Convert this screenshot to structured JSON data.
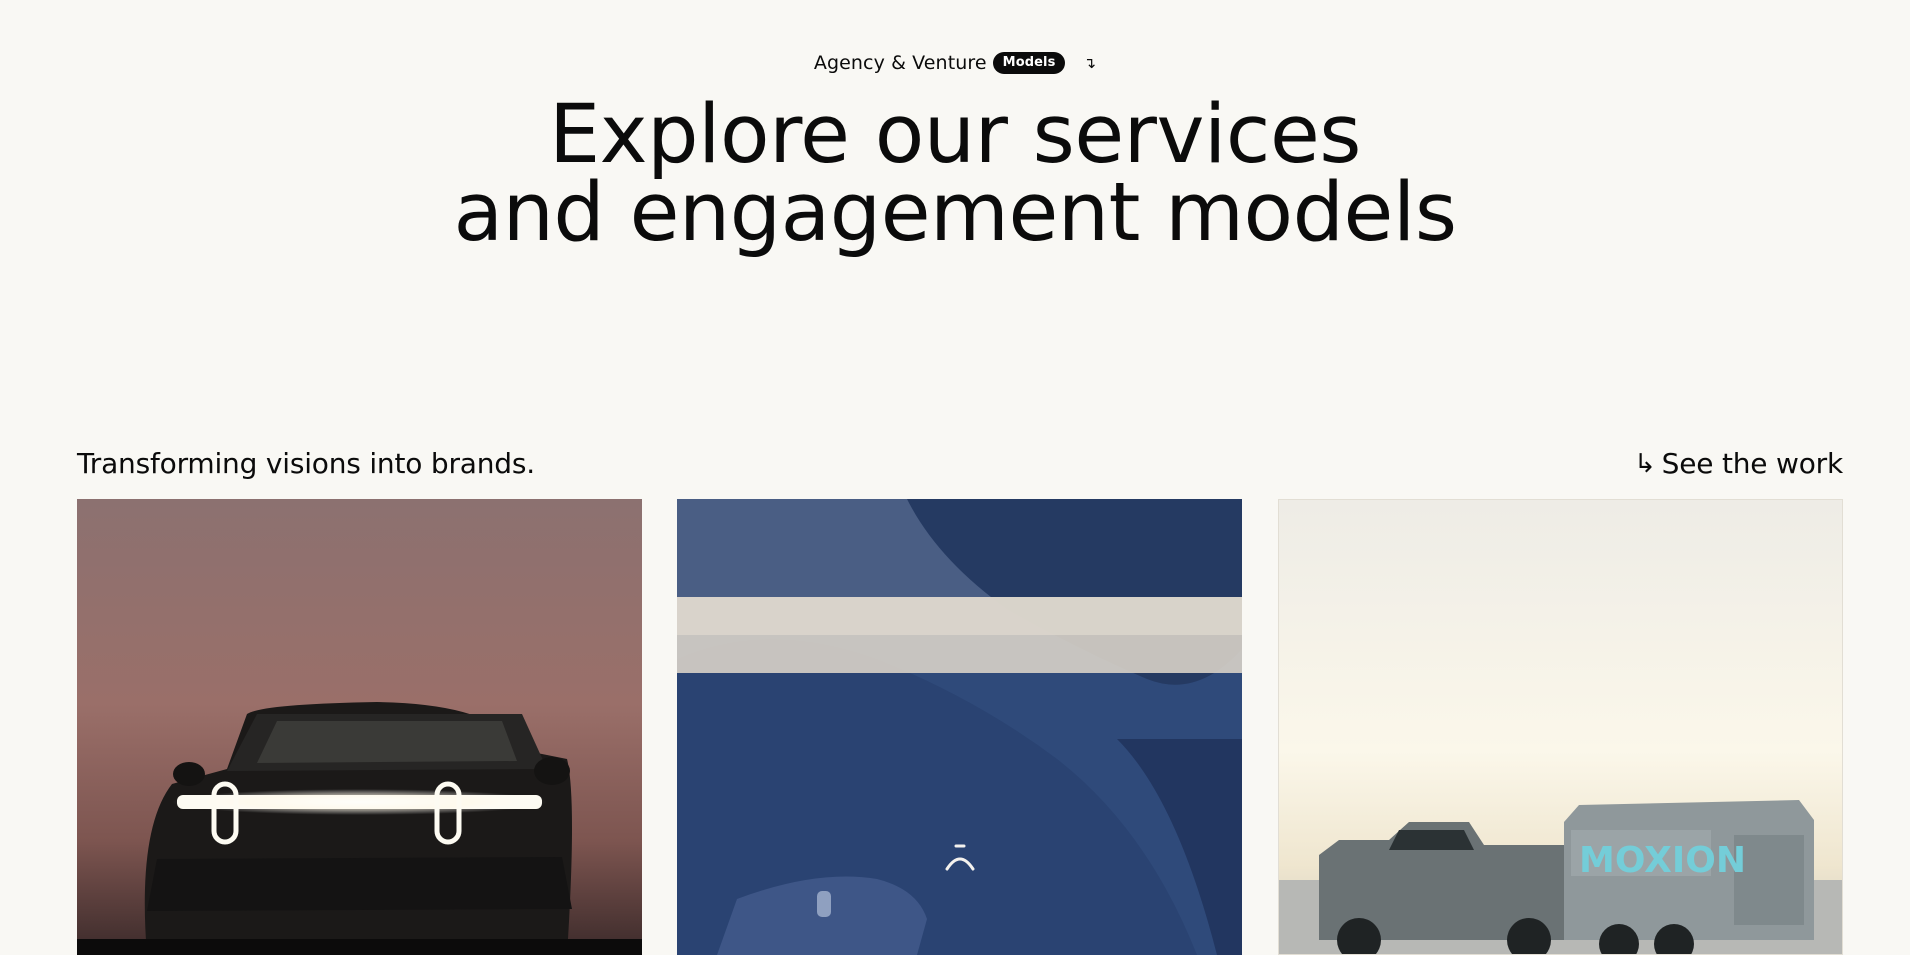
{
  "eyebrow": {
    "text": "Agency & Venture",
    "pill": "Models",
    "arrow": "↴"
  },
  "headline": {
    "line1": "Explore our services",
    "line2": "and engagement models"
  },
  "section": {
    "title": "Transforming visions into brands.",
    "link_icon": "↳",
    "link_label": "See the work"
  },
  "cards": [
    {
      "name": "card-truck",
      "icon": "truck-photo"
    },
    {
      "name": "card-portrait",
      "icon": "portrait-photo"
    },
    {
      "name": "card-moxion",
      "icon": "trailer-photo",
      "brand_text": "MOXION"
    }
  ],
  "colors": {
    "background": "#f9f8f4",
    "text": "#0b0b0b",
    "pill_bg": "#0b0b0b",
    "card2_blue": "#2f4a7a"
  }
}
